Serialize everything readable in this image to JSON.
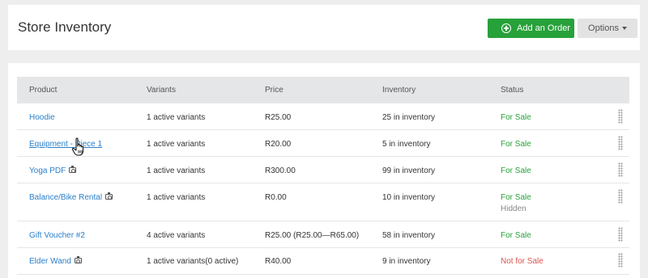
{
  "header": {
    "title": "Store Inventory",
    "add_order_label": "Add an Order",
    "options_label": "Options"
  },
  "table": {
    "columns": [
      "Product",
      "Variants",
      "Price",
      "Inventory",
      "Status"
    ],
    "rows": [
      {
        "product": "Hoodie",
        "variants": "1 active variants",
        "price": "R25.00",
        "inventory": "25 in inventory",
        "status": "For Sale"
      },
      {
        "product": "Equipment - Piece 1",
        "variants": "1 active variants",
        "price": "R20.00",
        "inventory": "5 in inventory",
        "status": "For Sale"
      },
      {
        "product": "Yoga PDF",
        "variants": "1 active variants",
        "price": "R300.00",
        "inventory": "99 in inventory",
        "status": "For Sale"
      },
      {
        "product": "Balance/Bike Rental",
        "variants": "1 active variants",
        "price": "R0.00",
        "inventory": "10 in inventory",
        "status": "For Sale",
        "status_note": "Hidden"
      },
      {
        "product": "Gift Voucher #2",
        "variants": "4 active variants",
        "price": "R25.00 (R25.00—R65.00)",
        "inventory": "58 in inventory",
        "status": "For Sale"
      },
      {
        "product": "Elder Wand",
        "variants": "1 active variants(0 active)",
        "price": "R40.00",
        "inventory": "9 in inventory",
        "status": "Not for Sale"
      }
    ]
  },
  "icons": {
    "add": "plus-circle-icon",
    "options_caret": "caret-down-icon",
    "photo": "camera-icon",
    "drag": "drag-handle-icon",
    "cursor": "hand-pointer-cursor"
  },
  "colors": {
    "primary_button": "#27a13a",
    "link": "#2a7fc9",
    "for_sale": "#28a23a",
    "not_for_sale": "#d9534f",
    "header_bg": "#e5e6e8"
  }
}
